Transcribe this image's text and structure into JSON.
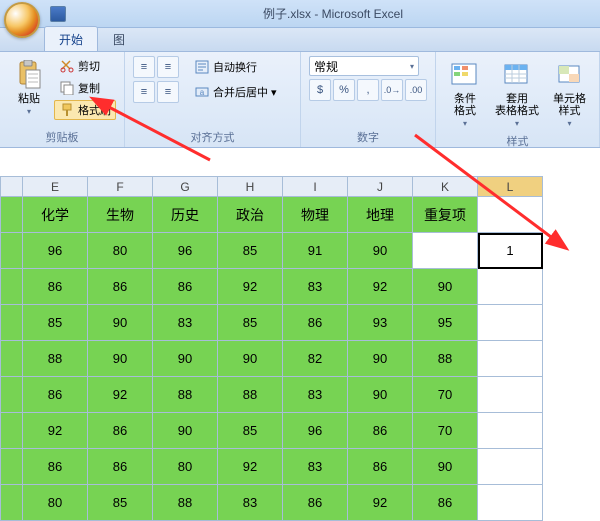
{
  "title": "例子.xlsx - Microsoft Excel",
  "tabs": {
    "home": "开始",
    "other": "图"
  },
  "clipboard": {
    "paste": "粘贴",
    "cut": "剪切",
    "copy": "复制",
    "formatPainter": "格式刷",
    "groupLabel": "剪贴板"
  },
  "alignment": {
    "wrap": "自动换行",
    "merge": "合并后居中",
    "groupLabel": "对齐方式"
  },
  "number": {
    "format": "常规",
    "groupLabel": "数字"
  },
  "styles": {
    "cond": "条件格式",
    "tablefmt": "套用\n表格格式",
    "cellStyle": "单元格\n样式",
    "groupLabel": "样式"
  },
  "columns": [
    "E",
    "F",
    "G",
    "H",
    "I",
    "J",
    "K",
    "L"
  ],
  "headerRow": [
    "化学",
    "生物",
    "历史",
    "政治",
    "物理",
    "地理",
    "重复项",
    ""
  ],
  "rows": [
    [
      "96",
      "80",
      "96",
      "85",
      "91",
      "90",
      "",
      "1"
    ],
    [
      "86",
      "86",
      "86",
      "92",
      "83",
      "92",
      "90",
      ""
    ],
    [
      "85",
      "90",
      "83",
      "85",
      "86",
      "93",
      "95",
      ""
    ],
    [
      "88",
      "90",
      "90",
      "90",
      "82",
      "90",
      "88",
      ""
    ],
    [
      "86",
      "92",
      "88",
      "88",
      "83",
      "90",
      "70",
      ""
    ],
    [
      "92",
      "86",
      "90",
      "85",
      "96",
      "86",
      "70",
      ""
    ],
    [
      "86",
      "86",
      "80",
      "92",
      "83",
      "86",
      "90",
      ""
    ],
    [
      "80",
      "85",
      "88",
      "83",
      "86",
      "92",
      "86",
      ""
    ]
  ],
  "selectedCol": 7,
  "selectedRow": 0
}
